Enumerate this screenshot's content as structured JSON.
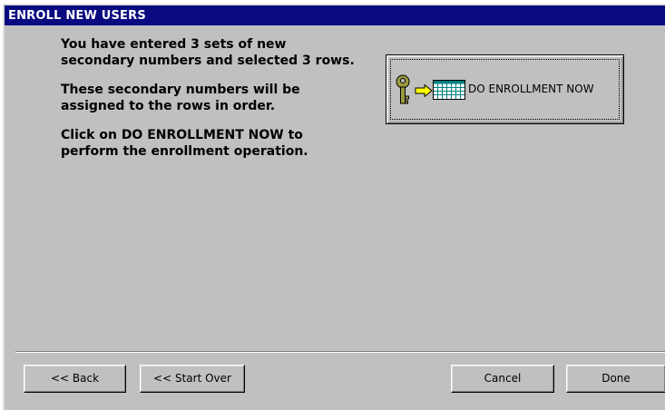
{
  "window": {
    "title": "ENROLL NEW USERS"
  },
  "instructions": {
    "paragraph1": "You have entered 3 sets of new secondary numbers and selected 3 rows.",
    "paragraph2": "These secondary numbers will be assigned to the rows in order.",
    "paragraph3": "Click on DO ENROLLMENT NOW to perform the enrollment operation."
  },
  "enroll_button": {
    "label": "DO ENROLLMENT NOW",
    "icons": [
      "key-icon",
      "arrow-icon",
      "grid-icon"
    ]
  },
  "footer": {
    "back_label": "<< Back",
    "start_over_label": "<< Start Over",
    "cancel_label": "Cancel",
    "done_label": "Done"
  },
  "colors": {
    "titlebar": "#0a0a80",
    "dialog_face": "#c0c0c0",
    "key": "#8a8a3a",
    "arrow": "#ffff00",
    "grid": "#008080"
  }
}
